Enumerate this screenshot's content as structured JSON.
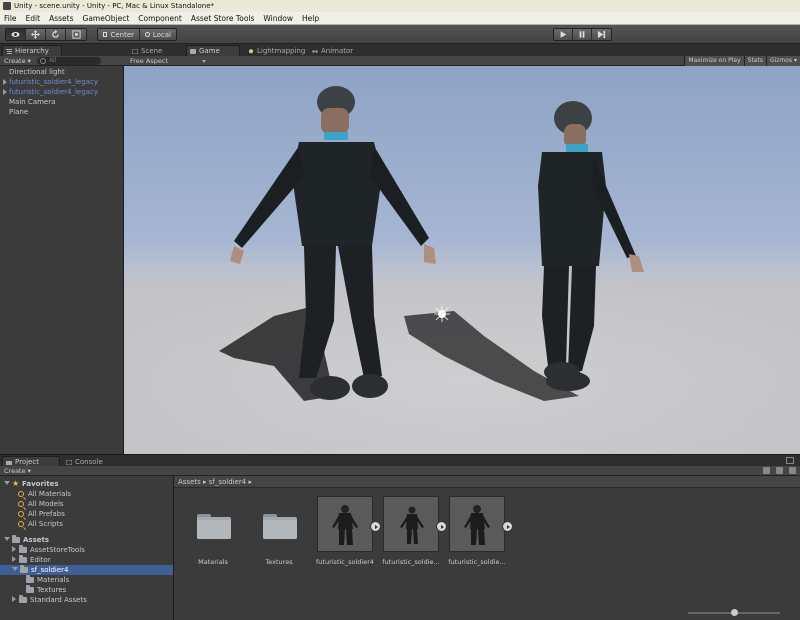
{
  "window": {
    "title": "Unity - scene.unity - Unity - PC, Mac & Linux Standalone*"
  },
  "menu": [
    "File",
    "Edit",
    "Assets",
    "GameObject",
    "Component",
    "Asset Store Tools",
    "Window",
    "Help"
  ],
  "toolbar": {
    "pivot_center": "Center",
    "pivot_local": "Local",
    "tools": [
      "eye-icon",
      "move-icon",
      "rotate-icon",
      "scale-icon"
    ],
    "playback": [
      "play-icon",
      "pause-icon",
      "step-icon"
    ]
  },
  "hierarchy": {
    "tab": "Hierarchy",
    "create": "Create ▾",
    "search_placeholder": "All",
    "items": [
      {
        "label": "Directional light",
        "prefab": false,
        "foldout": false
      },
      {
        "label": "futuristic_soldier4_legacy",
        "prefab": true,
        "foldout": true
      },
      {
        "label": "futuristic_soldier4_legacy",
        "prefab": true,
        "foldout": true
      },
      {
        "label": "Main Camera",
        "prefab": false,
        "foldout": false
      },
      {
        "label": "Plane",
        "prefab": false,
        "foldout": false
      }
    ]
  },
  "game_view": {
    "tabs": [
      "Scene",
      "Game",
      "Lightmapping",
      "Animator"
    ],
    "active_tab": "Game",
    "aspect": "Free Aspect",
    "options": [
      "Maximize on Play",
      "Stats",
      "Gizmos ▾"
    ]
  },
  "project": {
    "tabs": [
      "Project",
      "Console"
    ],
    "create": "Create ▾",
    "favorites_label": "Favorites",
    "favorites": [
      "All Materials",
      "All Models",
      "All Prefabs",
      "All Scripts"
    ],
    "assets_label": "Assets",
    "tree": [
      {
        "label": "AssetStoreTools",
        "level": 1
      },
      {
        "label": "Editor",
        "level": 1
      },
      {
        "label": "sf_soldier4",
        "level": 1
      },
      {
        "label": "Materials",
        "level": 2
      },
      {
        "label": "Textures",
        "level": 2
      },
      {
        "label": "Standard Assets",
        "level": 1
      }
    ],
    "breadcrumb": "Assets ▸ sf_soldier4 ▸",
    "assets": [
      {
        "label": "Materials",
        "kind": "folder"
      },
      {
        "label": "Textures",
        "kind": "folder"
      },
      {
        "label": "futuristic_soldier4",
        "kind": "model"
      },
      {
        "label": "futuristic_soldie...",
        "kind": "model"
      },
      {
        "label": "futuristic_soldie...",
        "kind": "model"
      }
    ],
    "thumbnail_zoom": 0.5
  }
}
